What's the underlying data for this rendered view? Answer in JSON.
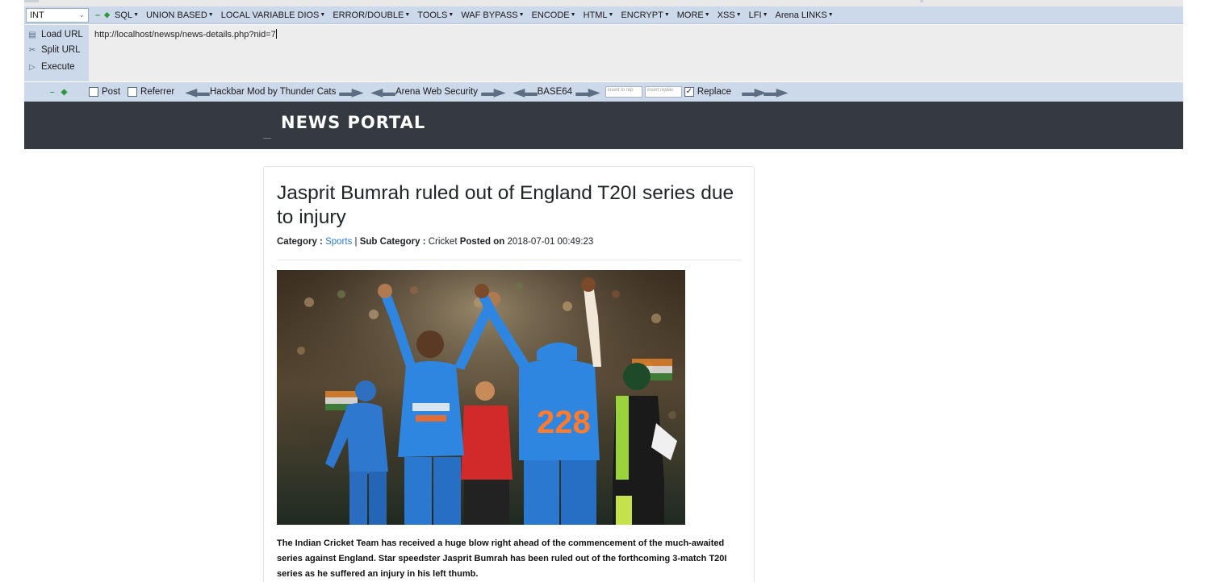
{
  "hackbar": {
    "encoding_select": "INT",
    "menu": [
      "SQL",
      "UNION BASED",
      "LOCAL VARIABLE DIOS",
      "ERROR/DOUBLE",
      "TOOLS",
      "WAF BYPASS",
      "ENCODE",
      "HTML",
      "ENCRYPT",
      "MORE",
      "XSS",
      "LFI",
      "Arena LINKS"
    ],
    "actions": {
      "load_url": "Load URL",
      "split_url": "Split URL",
      "execute": "Execute"
    },
    "url_value": "http://localhost/newsp/news-details.php?nid=7",
    "options": {
      "post": "Post",
      "referrer": "Referrer",
      "hackbar_mod": "Hackbar Mod by Thunder Cats",
      "arena": "Arena Web Security",
      "base64": "BASE64",
      "insert_replace_1": "insert to rep",
      "insert_replace_2": "insert replac",
      "replace": "Replace"
    }
  },
  "site": {
    "brand": "NEWS PORTAL"
  },
  "article": {
    "title": "Jasprit Bumrah ruled out of England T20I series due to injury",
    "category_label": "Category :",
    "category": "Sports",
    "separator": "|",
    "subcategory_label": "Sub Category :",
    "subcategory": "Cricket",
    "posted_label": "Posted on",
    "posted_on": "2018-07-01 00:49:23",
    "body": "The Indian Cricket Team has received a huge blow right ahead of the commencement of the much-awaited series against England. Star speedster Jasprit Bumrah has been ruled out of the forthcoming 3-match T20I series as he suffered an injury in his left thumb."
  },
  "colors": {
    "hackbar_bg": "#ccd9ea",
    "nav_bg": "#343a40",
    "link": "#2a7ae2"
  }
}
